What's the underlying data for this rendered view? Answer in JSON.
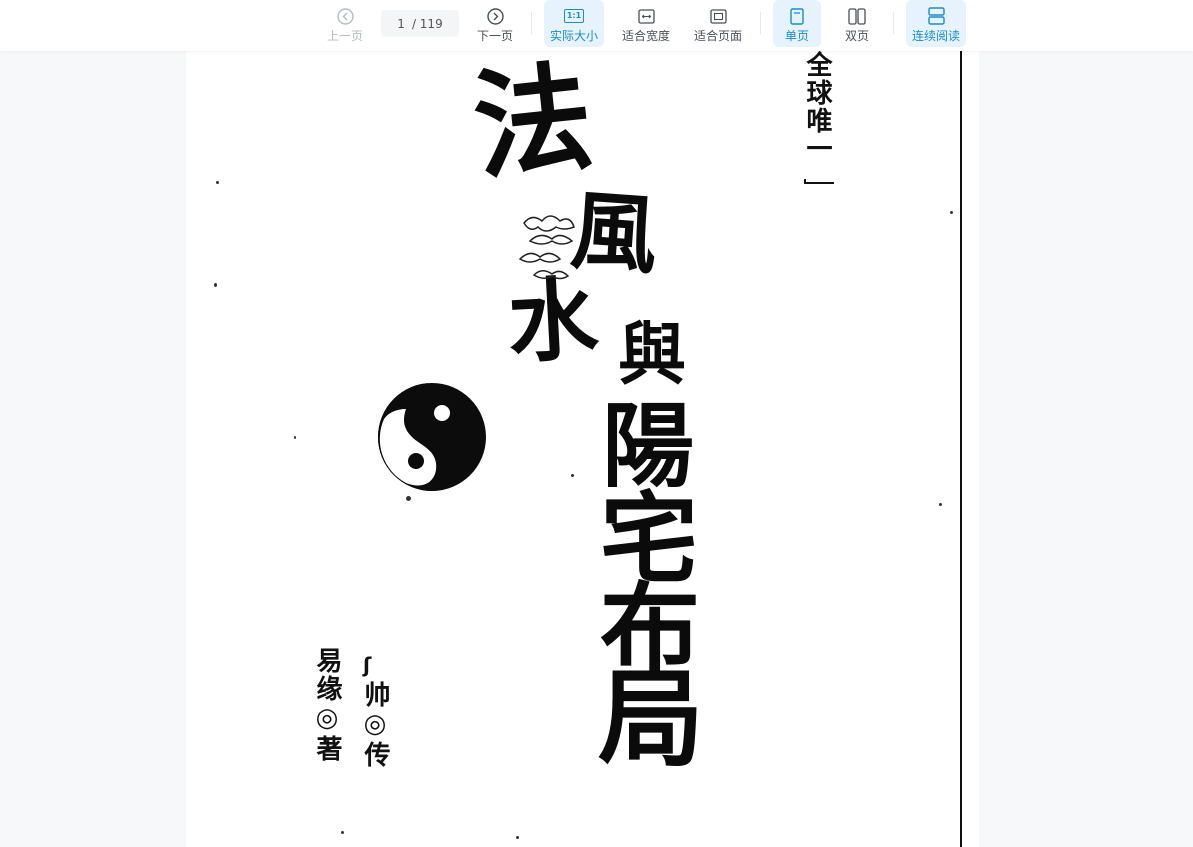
{
  "toolbar": {
    "prev_label": "上一页",
    "page_current": "1",
    "page_total": "/ 119",
    "next_label": "下一页",
    "actual_size_label": "实际大小",
    "actual_size_icon_text": "1:1",
    "fit_width_label": "适合宽度",
    "fit_page_label": "适合页面",
    "single_page_label": "单页",
    "double_page_label": "双页",
    "continuous_label": "连续阅读",
    "active_color": "#1a8ccc"
  },
  "icons": {
    "prev": "circle-chevron-left-icon",
    "next": "circle-chevron-right-icon",
    "actual_size": "one-to-one-icon",
    "fit_width": "fit-width-icon",
    "fit_page": "fit-page-icon",
    "single_page": "single-page-icon",
    "double_page": "double-page-icon",
    "continuous": "continuous-scroll-icon"
  },
  "document": {
    "cover": {
      "title_chars": [
        "法",
        "風",
        "水"
      ],
      "connector": "與",
      "subtitle_chars": [
        "陽",
        "宅",
        "布",
        "局"
      ],
      "side_banner": "全球唯一",
      "author": "易缘◎著",
      "transmitter": "帅◎传"
    }
  }
}
